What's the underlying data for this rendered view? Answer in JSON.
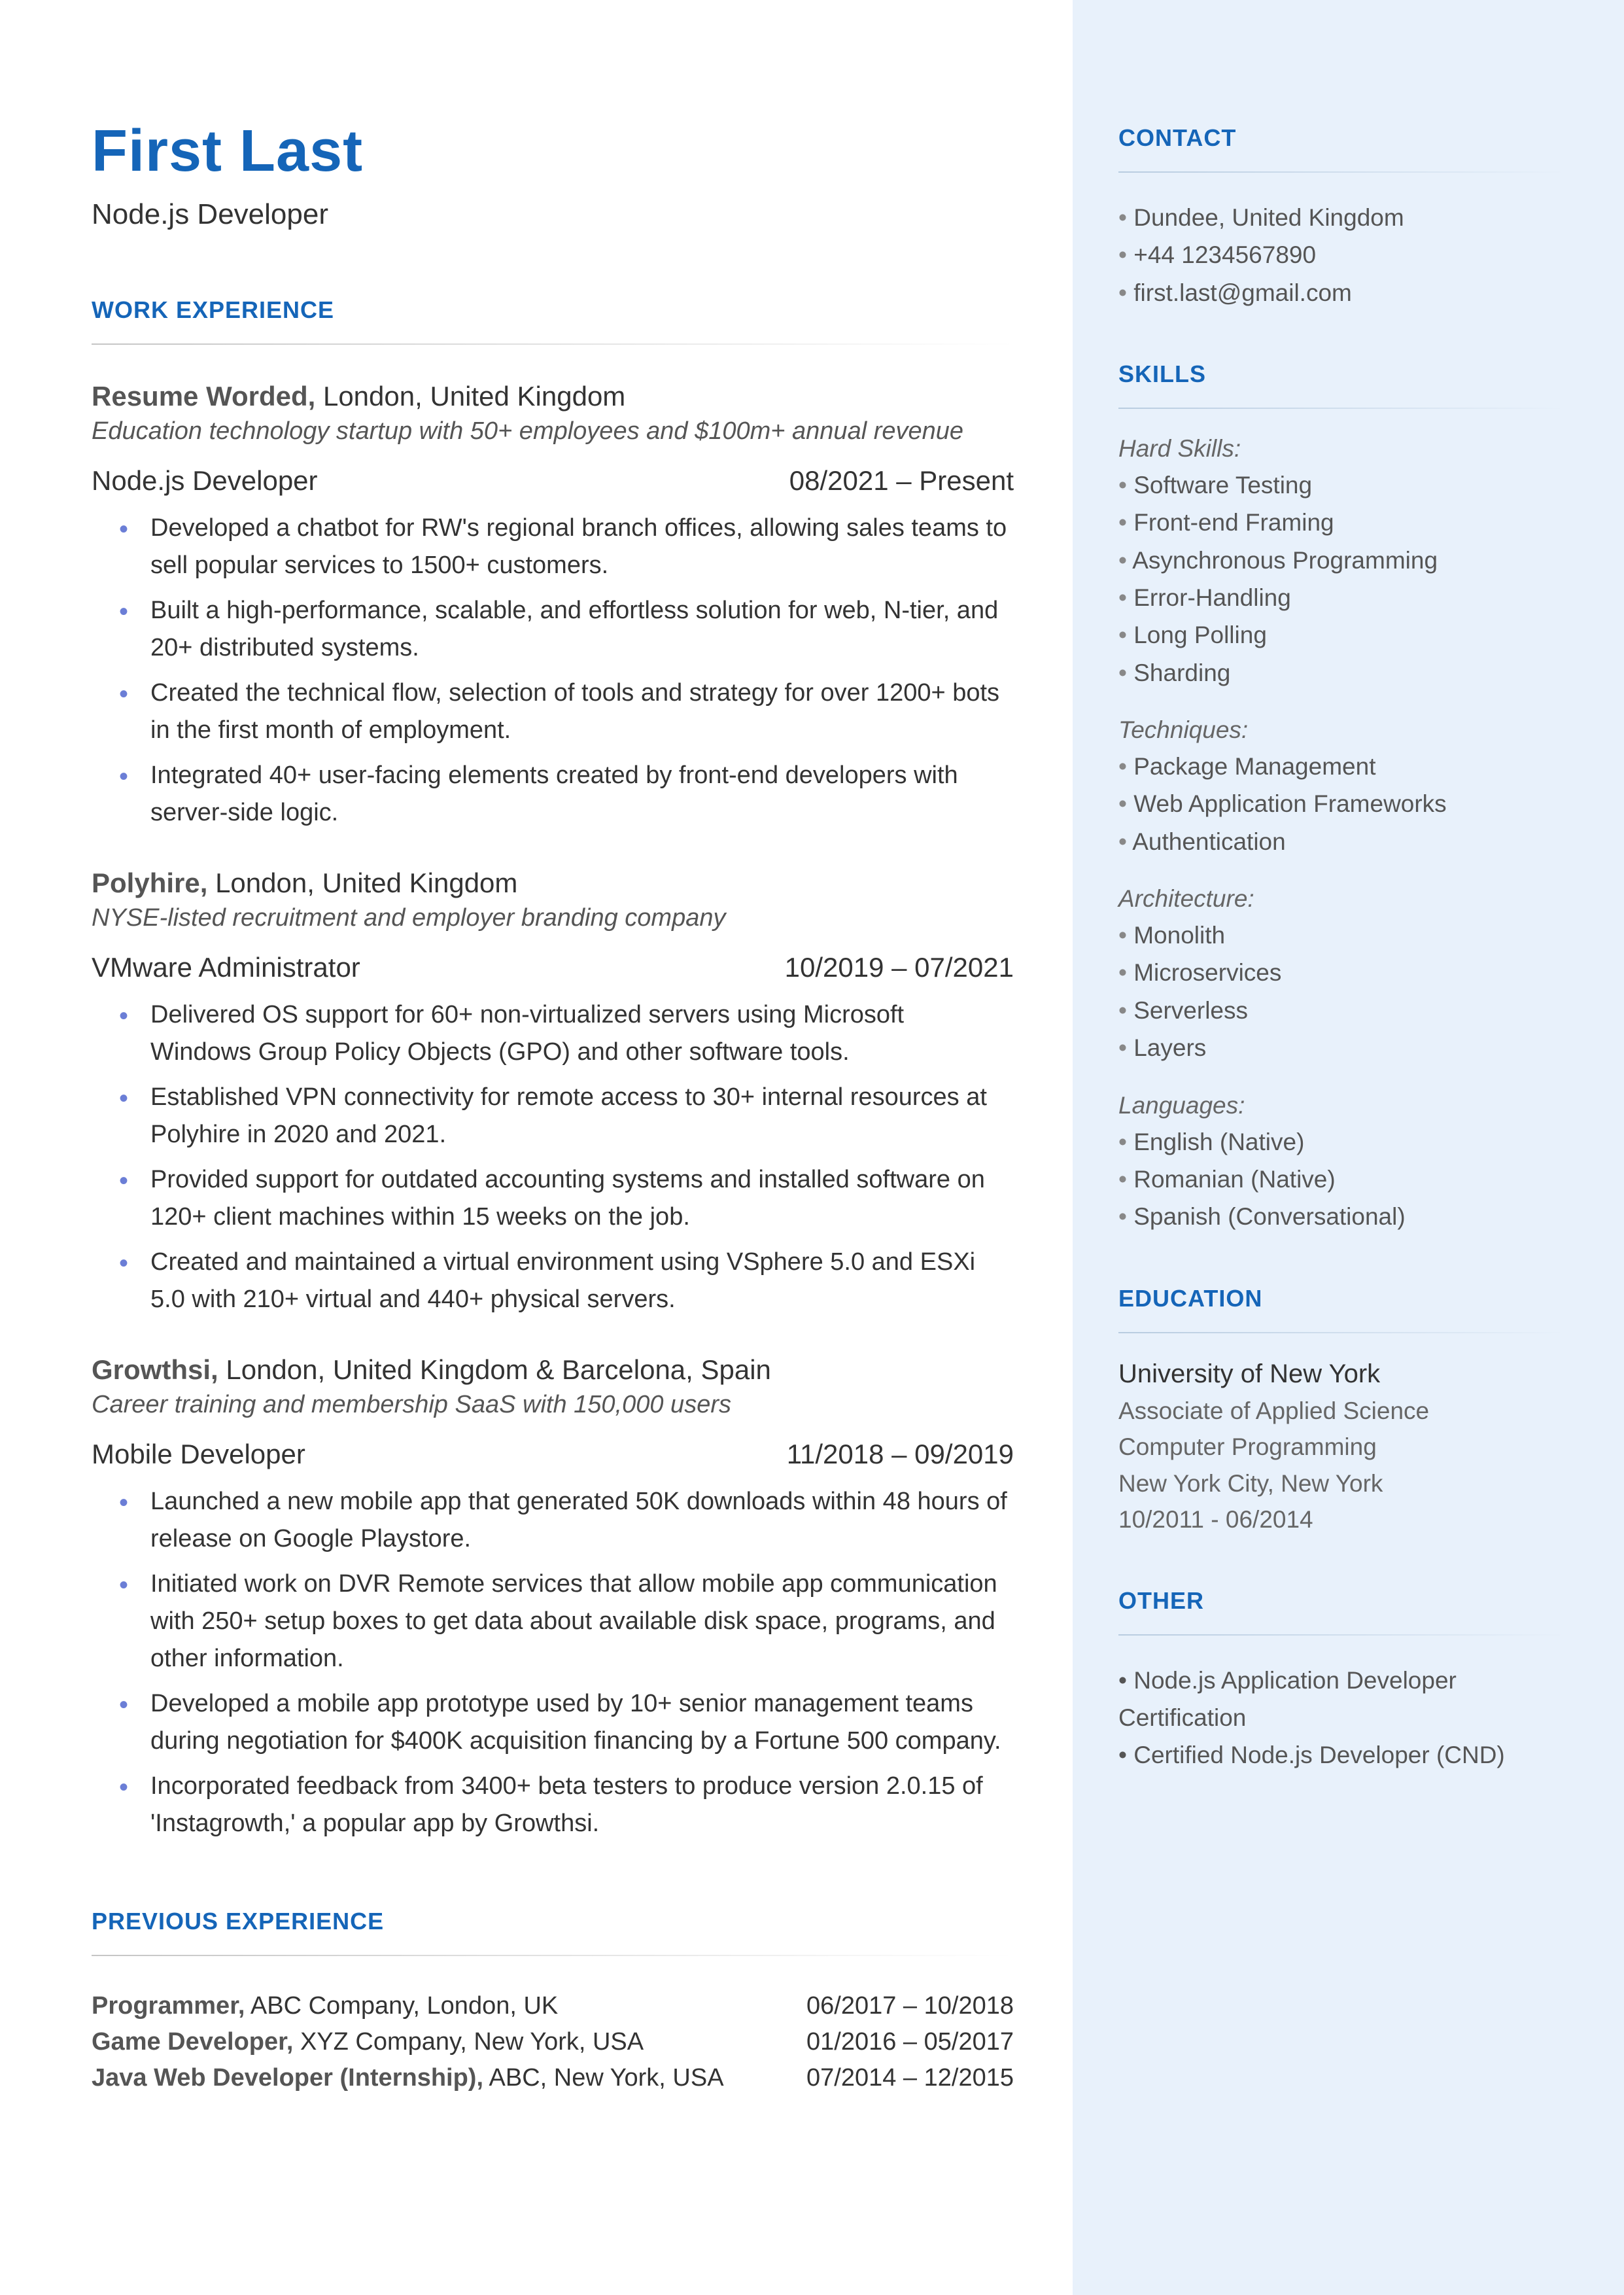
{
  "header": {
    "name": "First Last",
    "title": "Node.js Developer"
  },
  "sections": {
    "work": "WORK EXPERIENCE",
    "prev": "PREVIOUS EXPERIENCE"
  },
  "jobs": [
    {
      "company": "Resume Worded,",
      "location": "London, United Kingdom",
      "desc": "Education technology startup with 50+ employees and $100m+ annual revenue",
      "role": "Node.js Developer",
      "dates": "08/2021 – Present",
      "bullets": [
        "Developed a chatbot for RW's regional branch offices, allowing sales teams to sell popular services to 1500+ customers.",
        "Built a high-performance, scalable, and effortless solution for web, N-tier, and 20+ distributed systems.",
        "Created the technical flow, selection of tools and strategy for over 1200+ bots in the first month of employment.",
        "Integrated 40+ user-facing elements created by front-end developers with server-side logic."
      ]
    },
    {
      "company": "Polyhire,",
      "location": "London, United Kingdom",
      "desc": "NYSE-listed recruitment and employer branding company",
      "role": "VMware Administrator",
      "dates": "10/2019 – 07/2021",
      "bullets": [
        "Delivered OS support for 60+ non-virtualized servers using Microsoft Windows Group Policy Objects (GPO) and other software tools.",
        "Established VPN connectivity for remote access to 30+ internal resources at Polyhire in 2020 and 2021.",
        "Provided support for outdated accounting systems and installed software on 120+ client machines within 15 weeks on the job.",
        "Created and maintained a virtual environment using VSphere 5.0 and ESXi 5.0 with 210+ virtual and 440+ physical servers."
      ]
    },
    {
      "company": "Growthsi,",
      "location": "London, United Kingdom & Barcelona, Spain",
      "desc": "Career training and membership SaaS with 150,000 users",
      "role": "Mobile Developer",
      "dates": "11/2018 – 09/2019",
      "bullets": [
        "Launched a new mobile app that generated 50K downloads within 48 hours of release on Google Playstore.",
        "Initiated work on DVR Remote services that allow mobile app communication with 250+ setup boxes to get data about available disk space, programs, and other information.",
        "Developed a mobile app prototype used by 10+ senior management teams during negotiation for $400K acquisition financing by a Fortune 500 company.",
        "Incorporated feedback from 3400+ beta testers to produce version 2.0.15 of 'Instagrowth,' a popular app by Growthsi."
      ]
    }
  ],
  "previous": [
    {
      "role": "Programmer,",
      "company": "ABC Company, London, UK",
      "dates": "06/2017 – 10/2018"
    },
    {
      "role": "Game Developer,",
      "company": "XYZ Company, New York, USA",
      "dates": "01/2016 – 05/2017"
    },
    {
      "role": "Java Web Developer (Internship),",
      "company": "ABC, New York, USA",
      "dates": "07/2014 – 12/2015"
    }
  ],
  "sidebar": {
    "contact": {
      "heading": "CONTACT",
      "items": [
        "Dundee, United Kingdom",
        "+44 1234567890",
        "first.last@gmail.com"
      ]
    },
    "skills": {
      "heading": "SKILLS",
      "groups": [
        {
          "label": "Hard Skills:",
          "items": [
            "Software Testing",
            "Front-end Framing",
            "Asynchronous Programming",
            "Error-Handling",
            "Long Polling",
            "Sharding"
          ]
        },
        {
          "label": "Techniques:",
          "items": [
            "Package Management",
            "Web Application Frameworks",
            "Authentication"
          ]
        },
        {
          "label": "Architecture:",
          "items": [
            "Monolith",
            "Microservices",
            "Serverless",
            "Layers"
          ]
        },
        {
          "label": "Languages:",
          "items": [
            "English (Native)",
            "Romanian (Native)",
            "Spanish (Conversational)"
          ]
        }
      ]
    },
    "education": {
      "heading": "EDUCATION",
      "school": "University of New York",
      "degree": "Associate of Applied Science",
      "field": "Computer Programming",
      "place": "New York City, New York",
      "dates": "10/2011 - 06/2014"
    },
    "other": {
      "heading": "OTHER",
      "items": [
        "• Node.js Application Developer Certification",
        "• Certified Node.js Developer (CND)"
      ]
    }
  }
}
